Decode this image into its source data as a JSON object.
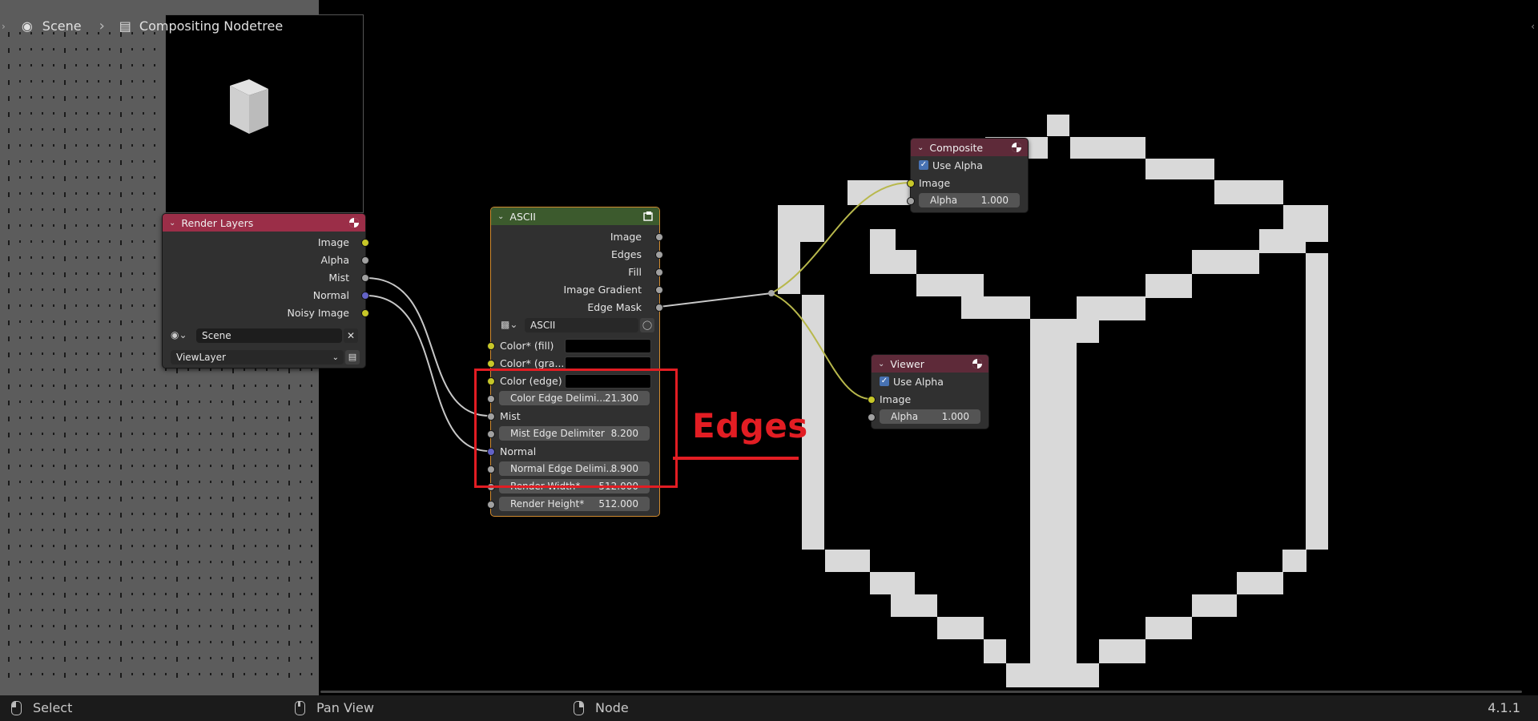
{
  "breadcrumb": {
    "scene": "Scene",
    "nodetree": "Compositing Nodetree"
  },
  "render_layers": {
    "title": "Render Layers",
    "outputs": [
      "Image",
      "Alpha",
      "Mist",
      "Normal",
      "Noisy Image"
    ],
    "scene": "Scene",
    "view_layer": "ViewLayer",
    "color": "#9b2e48"
  },
  "ascii": {
    "title": "ASCII",
    "outputs": [
      "Image",
      "Edges",
      "Fill",
      "Image Gradient",
      "Edge Mask"
    ],
    "group_name": "ASCII",
    "color_fill": "Color* (fill)",
    "color_gradient": "Color* (gra...",
    "color_edge": "Color (edge)",
    "color_edge_delim": {
      "label": "Color Edge Delimi...",
      "value": "21.300"
    },
    "mist": "Mist",
    "mist_edge_delim": {
      "label": "Mist Edge Delimiter",
      "value": "8.200"
    },
    "normal": "Normal",
    "normal_edge_delim": {
      "label": "Normal Edge Delimi...",
      "value": "8.900"
    },
    "render_width": {
      "label": "Render Width*",
      "value": "512.000"
    },
    "render_height": {
      "label": "Render Height*",
      "value": "512.000"
    },
    "color": "#3c5a2d"
  },
  "composite": {
    "title": "Composite",
    "use_alpha": "Use Alpha",
    "image": "Image",
    "alpha": {
      "label": "Alpha",
      "value": "1.000"
    },
    "color": "#5e2a39"
  },
  "viewer": {
    "title": "Viewer",
    "use_alpha": "Use Alpha",
    "image": "Image",
    "alpha": {
      "label": "Alpha",
      "value": "1.000"
    },
    "color": "#5e2a39"
  },
  "annotation": {
    "label": "Edges",
    "color": "#e21d23"
  },
  "statusbar": {
    "select": "Select",
    "pan_view": "Pan View",
    "node": "Node",
    "version": "4.1.1"
  }
}
